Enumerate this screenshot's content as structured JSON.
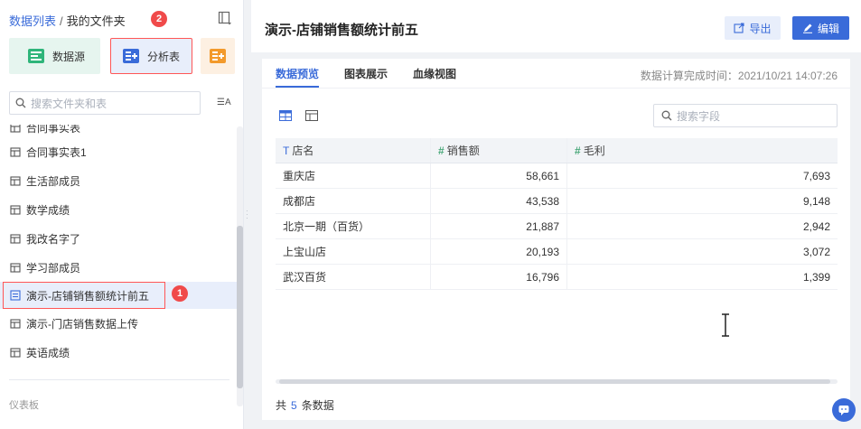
{
  "sidebar": {
    "breadcrumb": {
      "root": "数据列表",
      "separator": "/",
      "current": "我的文件夹"
    },
    "buttons": {
      "datasource": "数据源",
      "analysis": "分析表"
    },
    "search_placeholder": "搜索文件夹和表",
    "sort_label": "A",
    "clipped_item": "合同事实表",
    "items": [
      {
        "label": "合同事实表1",
        "icon": "table-icon"
      },
      {
        "label": "生活部成员",
        "icon": "table-icon"
      },
      {
        "label": "数学成绩",
        "icon": "table-icon"
      },
      {
        "label": "我改名字了",
        "icon": "table-icon"
      },
      {
        "label": "学习部成员",
        "icon": "table-icon"
      },
      {
        "label": "演示-店铺销售额统计前五",
        "icon": "analysis-table-icon",
        "selected": true
      },
      {
        "label": "演示-门店销售数据上传",
        "icon": "table-icon"
      },
      {
        "label": "英语成绩",
        "icon": "table-icon"
      }
    ],
    "section_label": "仪表板"
  },
  "annotations": {
    "step1": "1",
    "step2": "2"
  },
  "header": {
    "title": "演示-店铺销售额统计前五",
    "export_label": "导出",
    "edit_label": "编辑"
  },
  "tabs": [
    {
      "label": "数据预览",
      "active": true
    },
    {
      "label": "图表展示",
      "active": false
    },
    {
      "label": "血缘视图",
      "active": false
    }
  ],
  "calc_time": "数据计算完成时间：2021/10/21 14:07:26",
  "field_search_placeholder": "搜索字段",
  "table": {
    "columns": [
      {
        "type": "T",
        "name": "店名"
      },
      {
        "type": "#",
        "name": "销售额"
      },
      {
        "type": "#",
        "name": "毛利"
      }
    ],
    "rows": [
      [
        "重庆店",
        "58,661",
        "7,693"
      ],
      [
        "成都店",
        "43,538",
        "9,148"
      ],
      [
        "北京一期（百货）",
        "21,887",
        "2,942"
      ],
      [
        "上宝山店",
        "20,193",
        "3,072"
      ],
      [
        "武汉百货",
        "16,796",
        "1,399"
      ]
    ]
  },
  "footer": {
    "prefix": "共",
    "count": "5",
    "suffix": "条数据"
  },
  "colors": {
    "accent": "#3a6bd9",
    "highlight": "#ff5656",
    "number_field": "#4aa87a"
  }
}
